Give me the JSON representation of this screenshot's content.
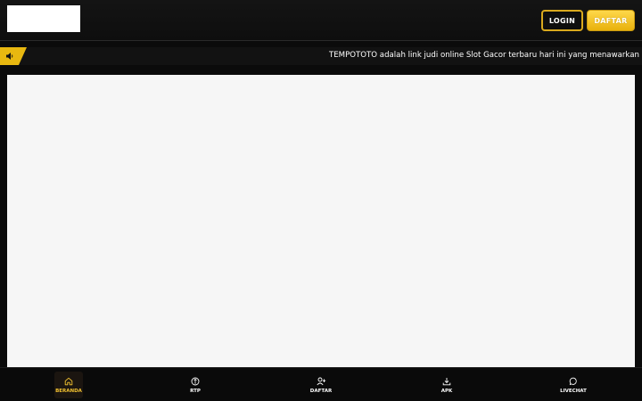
{
  "header": {
    "logo_icon": "logo-placeholder",
    "login_label": "LOGIN",
    "register_label": "DAFTAR"
  },
  "announcement": {
    "icon": "speaker-icon",
    "text": "TEMPOTOTO adalah link judi online Slot Gacor terbaru hari ini yang menawarkan koleks"
  },
  "bottom_nav": {
    "items": [
      {
        "label": "BERANDA",
        "icon": "home-icon",
        "active": true
      },
      {
        "label": "RTP",
        "icon": "rtp-icon",
        "active": false
      },
      {
        "label": "DAFTAR",
        "icon": "add-user-icon",
        "active": false
      },
      {
        "label": "APK",
        "icon": "download-icon",
        "active": false
      },
      {
        "label": "LIVECHAT",
        "icon": "chat-icon",
        "active": false
      }
    ]
  },
  "colors": {
    "accent": "#e8b810",
    "background": "#0b0b0b",
    "content_background": "#f6f6f6"
  }
}
